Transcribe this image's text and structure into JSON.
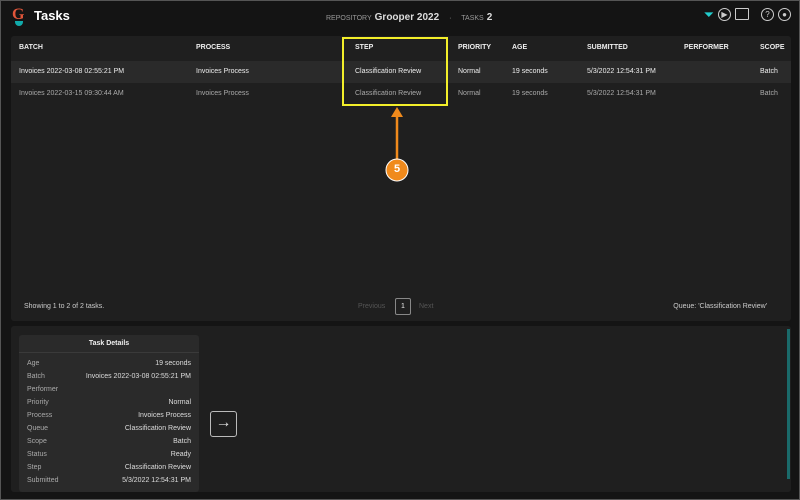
{
  "header": {
    "logo": "G",
    "title": "Tasks",
    "repository_label": "REPOSITORY",
    "repository": "Grooper 2022",
    "tasks_label": "TASKS",
    "tasks_count": "2"
  },
  "icons": [
    "filter-icon",
    "play-icon",
    "folder-add-icon",
    "help-icon",
    "user-icon"
  ],
  "table": {
    "columns": [
      "BATCH",
      "PROCESS",
      "STEP",
      "PRIORITY",
      "AGE",
      "SUBMITTED",
      "PERFORMER",
      "SCOPE"
    ],
    "rows": [
      [
        "Invoices 2022-03-08 02:55:21 PM",
        "Invoices Process",
        "Classification Review",
        "Normal",
        "19 seconds",
        "5/3/2022 12:54:31 PM",
        "",
        "Batch"
      ],
      [
        "Invoices 2022-03-15 09:30:44 AM",
        "Invoices Process",
        "Classification Review",
        "Normal",
        "19 seconds",
        "5/3/2022 12:54:31 PM",
        "",
        "Batch"
      ]
    ],
    "showing": "Showing 1 to 2 of 2 tasks.",
    "previous": "Previous",
    "page": "1",
    "next": "Next",
    "queue": "Queue: 'Classification Review'"
  },
  "annotation": {
    "badge": "5",
    "highlight_color": "#f2ee2a",
    "arrow_color": "#f08a1c"
  },
  "details": {
    "title": "Task Details",
    "items": [
      {
        "k": "Age",
        "v": "19 seconds"
      },
      {
        "k": "Batch",
        "v": "Invoices 2022-03-08 02:55:21 PM"
      },
      {
        "k": "Performer",
        "v": ""
      },
      {
        "k": "Priority",
        "v": "Normal"
      },
      {
        "k": "Process",
        "v": "Invoices Process"
      },
      {
        "k": "Queue",
        "v": "Classification Review"
      },
      {
        "k": "Scope",
        "v": "Batch"
      },
      {
        "k": "Status",
        "v": "Ready"
      },
      {
        "k": "Step",
        "v": "Classification Review"
      },
      {
        "k": "Submitted",
        "v": "5/3/2022 12:54:31 PM"
      }
    ]
  }
}
